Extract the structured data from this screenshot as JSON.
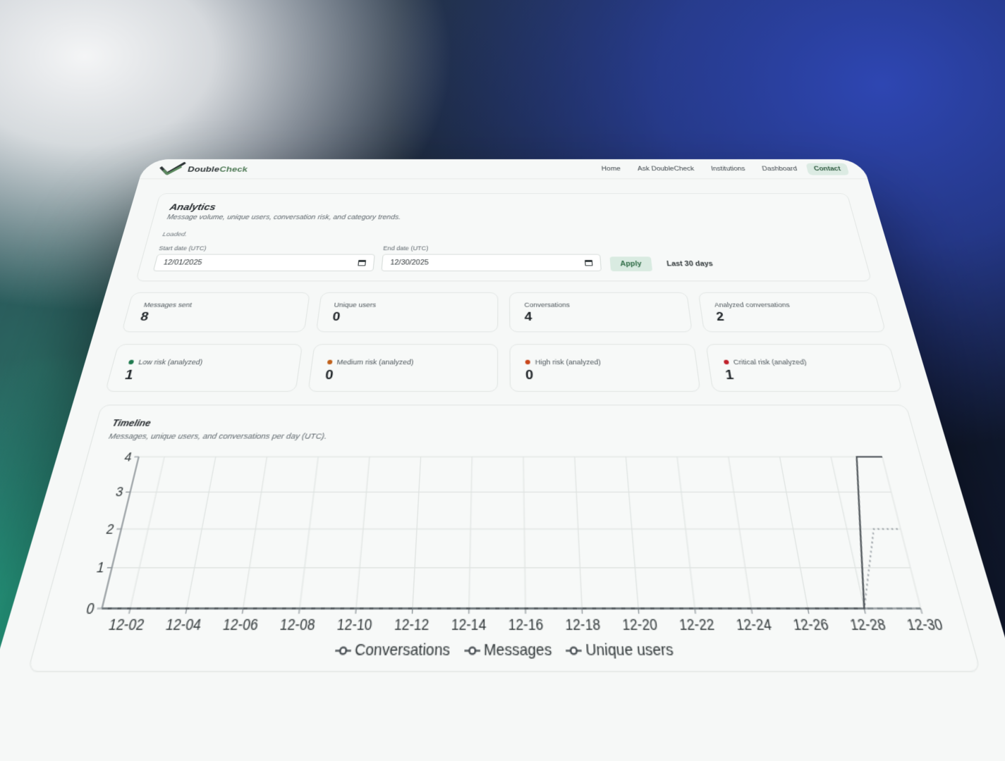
{
  "brand": {
    "name_part1": "Double",
    "name_part2": "Check"
  },
  "nav": {
    "items": [
      {
        "label": "Home"
      },
      {
        "label": "Ask DoubleCheck"
      },
      {
        "label": "Institutions"
      },
      {
        "label": "Dashboard"
      },
      {
        "label": "Contact",
        "active": true
      }
    ]
  },
  "analytics": {
    "title": "Analytics",
    "subtitle": "Message volume, unique users, conversation risk, and category trends.",
    "status": "Loaded.",
    "start_label": "Start date (UTC)",
    "start_value": "12/01/2025",
    "end_label": "End date (UTC)",
    "end_value": "12/30/2025",
    "apply_label": "Apply",
    "range_note": "Last 30 days"
  },
  "stats": [
    {
      "label": "Messages sent",
      "value": "8"
    },
    {
      "label": "Unique users",
      "value": "0"
    },
    {
      "label": "Conversations",
      "value": "4"
    },
    {
      "label": "Analyzed conversations",
      "value": "2"
    }
  ],
  "risk": [
    {
      "label": "Low risk (analyzed)",
      "value": "1",
      "color": "#1f7a4f"
    },
    {
      "label": "Medium risk (analyzed)",
      "value": "0",
      "color": "#c0601a"
    },
    {
      "label": "High risk (analyzed)",
      "value": "0",
      "color": "#c8451a"
    },
    {
      "label": "Critical risk (analyzed)",
      "value": "1",
      "color": "#c0202a"
    }
  ],
  "timeline": {
    "title": "Timeline",
    "subtitle": "Messages, unique users, and conversations per day (UTC)."
  },
  "chart_data": {
    "type": "line",
    "x": [
      "12-01",
      "12-02",
      "12-03",
      "12-04",
      "12-05",
      "12-06",
      "12-07",
      "12-08",
      "12-09",
      "12-10",
      "12-11",
      "12-12",
      "12-13",
      "12-14",
      "12-15",
      "12-16",
      "12-17",
      "12-18",
      "12-19",
      "12-20",
      "12-21",
      "12-22",
      "12-23",
      "12-24",
      "12-25",
      "12-26",
      "12-27",
      "12-28",
      "12-29",
      "12-30"
    ],
    "x_tick_labels": [
      "12-02",
      "12-04",
      "12-06",
      "12-08",
      "12-10",
      "12-12",
      "12-14",
      "12-16",
      "12-18",
      "12-20",
      "12-22",
      "12-24",
      "12-26",
      "12-28",
      "12-30"
    ],
    "y_ticks": [
      "0",
      "1",
      "2",
      "3",
      "4"
    ],
    "ylim": [
      0,
      4
    ],
    "grid": true,
    "legend_position": "bottom",
    "series": [
      {
        "name": "Conversations",
        "values": [
          0,
          0,
          0,
          0,
          0,
          0,
          0,
          0,
          0,
          0,
          0,
          0,
          0,
          0,
          0,
          0,
          0,
          0,
          0,
          0,
          0,
          0,
          0,
          0,
          0,
          0,
          0,
          0,
          2,
          2
        ],
        "color": "#9aa1a6",
        "dash": "dotted"
      },
      {
        "name": "Messages",
        "values": [
          0,
          0,
          0,
          0,
          0,
          0,
          0,
          0,
          0,
          0,
          0,
          0,
          0,
          0,
          0,
          0,
          0,
          0,
          0,
          0,
          0,
          0,
          0,
          0,
          0,
          0,
          0,
          0,
          4,
          4
        ],
        "color": "#3c4348",
        "dash": "solid"
      },
      {
        "name": "Unique users",
        "values": [
          0,
          0,
          0,
          0,
          0,
          0,
          0,
          0,
          0,
          0,
          0,
          0,
          0,
          0,
          0,
          0,
          0,
          0,
          0,
          0,
          0,
          0,
          0,
          0,
          0,
          0,
          0,
          0,
          0,
          0
        ],
        "color": "#7a8287",
        "dash": "dashed"
      }
    ]
  }
}
